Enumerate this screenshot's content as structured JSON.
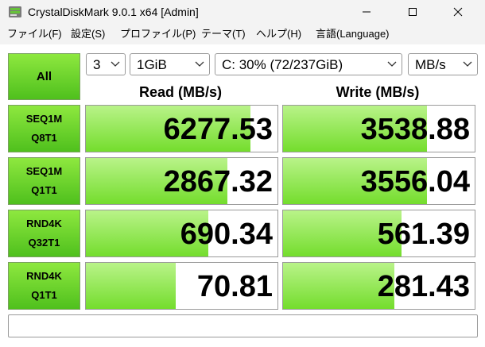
{
  "window": {
    "title": "CrystalDiskMark 9.0.1 x64 [Admin]",
    "controls": {
      "minimize_icon": "minimize-icon",
      "maximize_icon": "maximize-icon",
      "close_icon": "close-icon"
    }
  },
  "menu": [
    "ファイル(F)",
    "設定(S)",
    "プロファイル(P)",
    "テーマ(T)",
    "ヘルプ(H)",
    "言語(Language)"
  ],
  "controls": {
    "all_label": "All",
    "count": "3",
    "size": "1GiB",
    "drive": "C: 30% (72/237GiB)",
    "unit": "MB/s"
  },
  "headers": {
    "read": "Read (MB/s)",
    "write": "Write (MB/s)"
  },
  "tests": [
    {
      "line1": "SEQ1M",
      "line2": "Q8T1",
      "read": "6277.53",
      "write": "3538.88",
      "read_fill": 0.86,
      "write_fill": 0.75
    },
    {
      "line1": "SEQ1M",
      "line2": "Q1T1",
      "read": "2867.32",
      "write": "3556.04",
      "read_fill": 0.74,
      "write_fill": 0.75
    },
    {
      "line1": "RND4K",
      "line2": "Q32T1",
      "read": "690.34",
      "write": "561.39",
      "read_fill": 0.64,
      "write_fill": 0.62
    },
    {
      "line1": "RND4K",
      "line2": "Q1T1",
      "read": "70.81",
      "write": "281.43",
      "read_fill": 0.47,
      "write_fill": 0.58
    }
  ],
  "comment": "",
  "colors": {
    "accent_green": "#4fc01d",
    "bar_green": "#74dd2d",
    "titlebar": "#f3f3f3"
  }
}
